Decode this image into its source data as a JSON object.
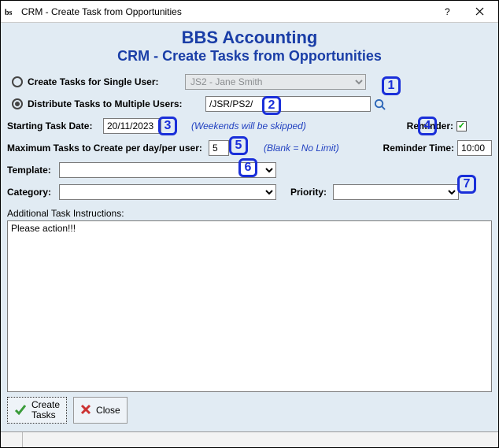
{
  "window": {
    "title": "CRM - Create Task from Opportunities"
  },
  "header": {
    "company": "BBS Accounting",
    "subtitle": "CRM - Create Tasks from Opportunities"
  },
  "singleUser": {
    "label": "Create Tasks for Single User:",
    "value": "JS2 - Jane Smith"
  },
  "multiUser": {
    "label": "Distribute Tasks to Multiple Users:",
    "value": "/JSR/PS2/"
  },
  "startDate": {
    "label": "Starting Task Date:",
    "value": "20/11/2023",
    "hint": "(Weekends will be skipped)"
  },
  "reminder": {
    "label": "Reminder:"
  },
  "maxTasks": {
    "label": "Maximum Tasks to Create per day/per user:",
    "value": "5",
    "hint": "(Blank = No Limit)"
  },
  "reminderTime": {
    "label": "Reminder Time:",
    "value": "10:00"
  },
  "template": {
    "label": "Template:",
    "value": ""
  },
  "category": {
    "label": "Category:",
    "value": ""
  },
  "priority": {
    "label": "Priority:",
    "value": ""
  },
  "instructions": {
    "label": "Additional Task Instructions:",
    "value": "Please action!!!"
  },
  "buttons": {
    "create": "Create\nTasks",
    "close": "Close"
  },
  "callouts": {
    "1": "1",
    "2": "2",
    "3": "3",
    "4": "4",
    "5": "5",
    "6": "6",
    "7": "7"
  }
}
